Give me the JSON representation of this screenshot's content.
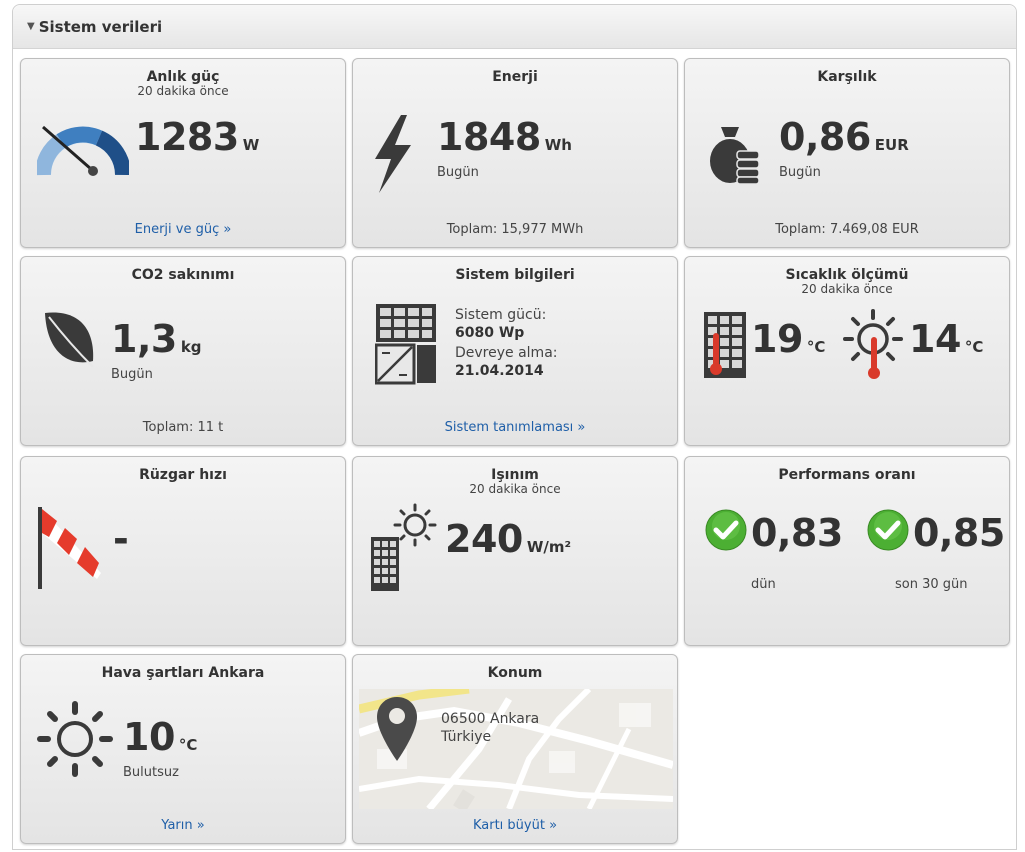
{
  "panel": {
    "title": "Sistem verileri"
  },
  "cards": {
    "power": {
      "title": "Anlık güç",
      "sub": "20 dakika önce",
      "value": "1283",
      "unit": "W",
      "link": "Enerji ve güç »"
    },
    "energy": {
      "title": "Enerji",
      "value": "1848",
      "unit": "Wh",
      "note": "Bugün",
      "total": "Toplam: 15,977 MWh"
    },
    "revenue": {
      "title": "Karşılık",
      "value": "0,86",
      "unit": "EUR",
      "note": "Bugün",
      "total": "Toplam: 7.469,08 EUR"
    },
    "co2": {
      "title": "CO2 sakınımı",
      "value": "1,3",
      "unit": "kg",
      "note": "Bugün",
      "total": "Toplam: 11 t"
    },
    "system": {
      "title": "Sistem bilgileri",
      "power_label": "Sistem gücü:",
      "power_value": "6080 Wp",
      "commission_label": "Devreye alma:",
      "commission_value": "21.04.2014",
      "link": "Sistem tanımlaması »"
    },
    "temp": {
      "title": "Sıcaklık ölçümü",
      "sub": "20 dakika önce",
      "module_value": "19",
      "module_unit": "°C",
      "ambient_value": "14",
      "ambient_unit": "°C"
    },
    "wind": {
      "title": "Rüzgar hızı",
      "value": "-"
    },
    "irradiance": {
      "title": "Işınım",
      "sub": "20 dakika önce",
      "value": "240",
      "unit": "W/m²"
    },
    "performance": {
      "title": "Performans oranı",
      "yesterday_value": "0,83",
      "yesterday_label": "dün",
      "month_value": "0,85",
      "month_label": "son 30 gün"
    },
    "weather": {
      "title": "Hava şartları Ankara",
      "value": "10",
      "unit": "°C",
      "condition": "Bulutsuz",
      "link": "Yarın »"
    },
    "location": {
      "title": "Konum",
      "address_line1": "06500 Ankara",
      "address_line2": "Türkiye",
      "link": "Kartı büyüt »"
    }
  },
  "colors": {
    "link": "#1f5fa8",
    "check_green": "#4caf33",
    "thermo_red": "#d93a2b",
    "windsock_red": "#e53b2c"
  }
}
